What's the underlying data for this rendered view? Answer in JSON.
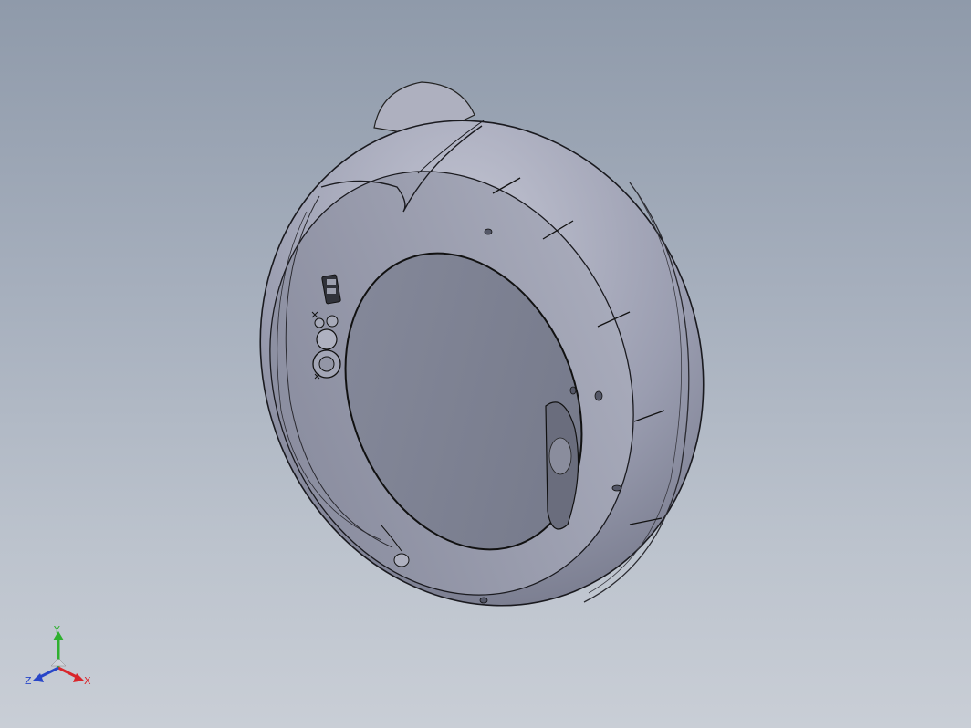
{
  "viewport": {
    "background_top": "#8f9aaa",
    "background_bottom": "#c9ced6"
  },
  "model": {
    "body_color": "#9a9db0",
    "lid_color": "#7f8393",
    "edge_color": "#1a1a1f"
  },
  "triad": {
    "x_label": "X",
    "y_label": "Y",
    "z_label": "Z",
    "x_color": "#d9262b",
    "y_color": "#2fb02f",
    "z_color": "#2846c8"
  }
}
